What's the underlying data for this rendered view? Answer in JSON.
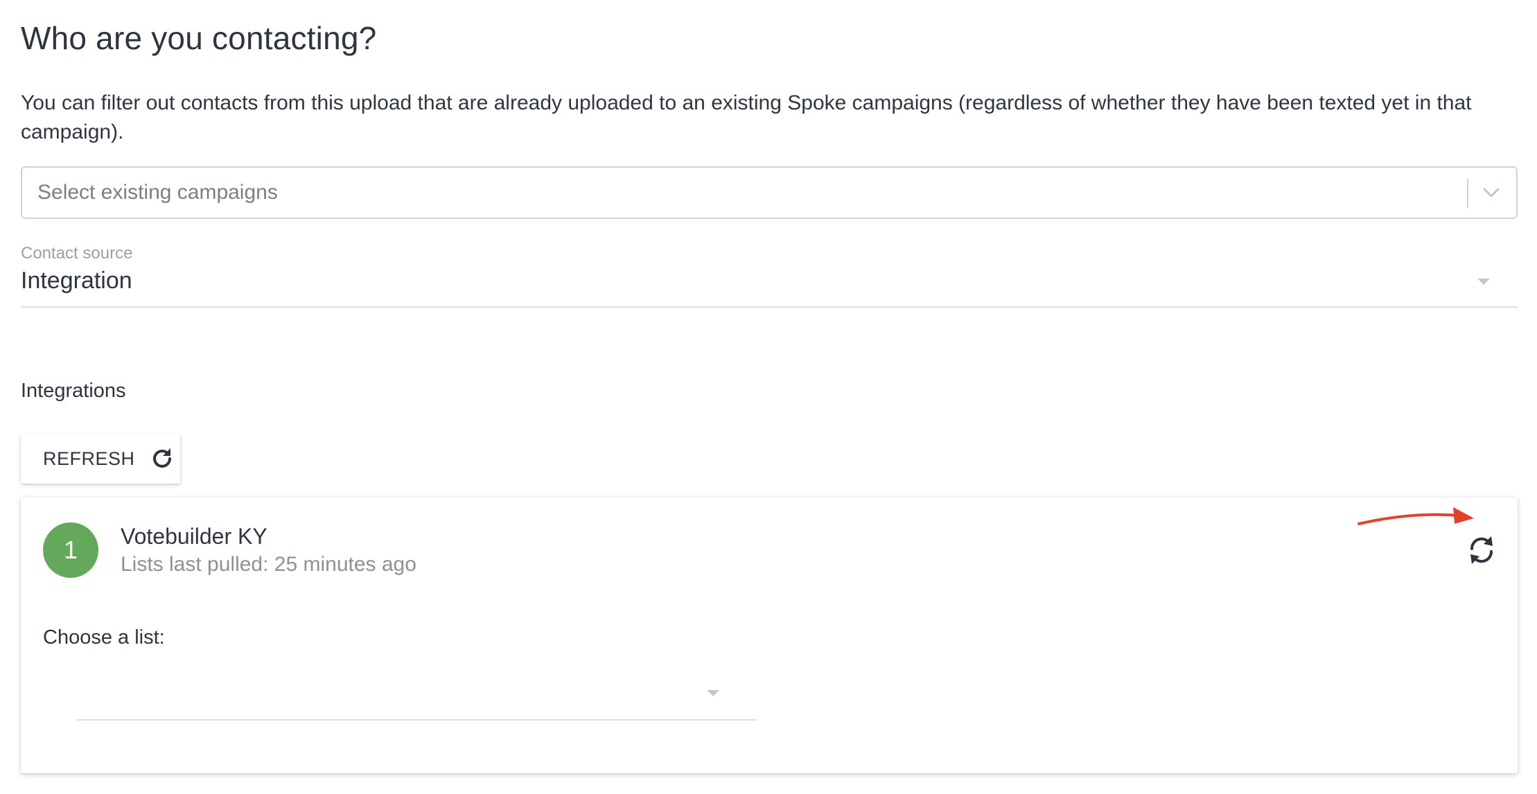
{
  "page": {
    "title": "Who are you contacting?",
    "description": "You can filter out contacts from this upload that are already uploaded to an existing Spoke campaigns (regardless of whether they have been texted yet in that campaign)."
  },
  "campaign_filter": {
    "placeholder": "Select existing campaigns",
    "icon": "chevron-down-icon"
  },
  "contact_source": {
    "label": "Contact source",
    "value": "Integration"
  },
  "integrations": {
    "section_title": "Integrations",
    "refresh_label": "REFRESH",
    "refresh_icon": "refresh-icon",
    "items": [
      {
        "badge": "1",
        "badge_color": "#64a85c",
        "name": "Votebuilder KY",
        "status": "Lists last pulled: 25 minutes ago",
        "sync_icon": "sync-icon",
        "choose_list_label": "Choose a list:",
        "selected_list": ""
      }
    ]
  },
  "annotation": {
    "arrow_color": "#e2412a"
  }
}
